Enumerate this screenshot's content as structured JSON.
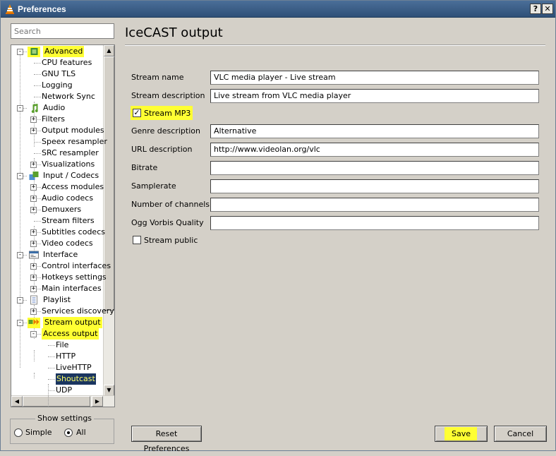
{
  "window": {
    "title": "Preferences",
    "help_button": "?",
    "close_button": "✕"
  },
  "search": {
    "placeholder": "Search"
  },
  "tree": {
    "items": [
      {
        "label": "Advanced",
        "level": 0,
        "expander": "−",
        "icon": "chip-icon",
        "highlight": true
      },
      {
        "label": "CPU features",
        "level": 1
      },
      {
        "label": "GNU TLS",
        "level": 1
      },
      {
        "label": "Logging",
        "level": 1
      },
      {
        "label": "Network Sync",
        "level": 1
      },
      {
        "label": "Audio",
        "level": 0,
        "expander": "−",
        "icon": "music-note-icon"
      },
      {
        "label": "Filters",
        "level": 1,
        "expander": "+"
      },
      {
        "label": "Output modules",
        "level": 1,
        "expander": "+"
      },
      {
        "label": "Speex resampler",
        "level": 1
      },
      {
        "label": "SRC resampler",
        "level": 1
      },
      {
        "label": "Visualizations",
        "level": 1,
        "expander": "+"
      },
      {
        "label": "Input / Codecs",
        "level": 0,
        "expander": "−",
        "icon": "codecs-icon"
      },
      {
        "label": "Access modules",
        "level": 1,
        "expander": "+"
      },
      {
        "label": "Audio codecs",
        "level": 1,
        "expander": "+"
      },
      {
        "label": "Demuxers",
        "level": 1,
        "expander": "+"
      },
      {
        "label": "Stream filters",
        "level": 1
      },
      {
        "label": "Subtitles codecs",
        "level": 1,
        "expander": "+"
      },
      {
        "label": "Video codecs",
        "level": 1,
        "expander": "+"
      },
      {
        "label": "Interface",
        "level": 0,
        "expander": "−",
        "icon": "interface-icon"
      },
      {
        "label": "Control interfaces",
        "level": 1,
        "expander": "+"
      },
      {
        "label": "Hotkeys settings",
        "level": 1,
        "expander": "+"
      },
      {
        "label": "Main interfaces",
        "level": 1,
        "expander": "+"
      },
      {
        "label": "Playlist",
        "level": 0,
        "expander": "−",
        "icon": "playlist-icon"
      },
      {
        "label": "Services discovery",
        "level": 1,
        "expander": "+"
      },
      {
        "label": "Stream output",
        "level": 0,
        "expander": "−",
        "icon": "stream-output-icon",
        "highlight": true
      },
      {
        "label": "Access output",
        "level": 1,
        "expander": "−",
        "highlight": true
      },
      {
        "label": "File",
        "level": 2
      },
      {
        "label": "HTTP",
        "level": 2
      },
      {
        "label": "LiveHTTP",
        "level": 2
      },
      {
        "label": "Shoutcast",
        "level": 2,
        "selected": true
      },
      {
        "label": "UDP",
        "level": 2
      }
    ]
  },
  "show_settings": {
    "title": "Show settings",
    "simple": "Simple",
    "all": "All",
    "selected": "All"
  },
  "panel": {
    "title": "IceCAST output",
    "fields": [
      {
        "label": "Stream name",
        "value": "VLC media player - Live stream"
      },
      {
        "label": "Stream description",
        "value": "Live stream from VLC media player"
      },
      {
        "label": "Genre description",
        "value": "Alternative"
      },
      {
        "label": "URL description",
        "value": "http://www.videolan.org/vlc"
      },
      {
        "label": "Bitrate",
        "value": ""
      },
      {
        "label": "Samplerate",
        "value": ""
      },
      {
        "label": "Number of channels",
        "value": ""
      },
      {
        "label": "Ogg Vorbis Quality",
        "value": ""
      }
    ],
    "stream_mp3": {
      "label": "Stream MP3",
      "checked": true
    },
    "stream_public": {
      "label": "Stream public",
      "checked": false
    }
  },
  "buttons": {
    "reset": "Reset Preferences",
    "save": "Save",
    "cancel": "Cancel"
  },
  "colors": {
    "highlight": "#ffff33",
    "selection": "#1a3560",
    "titlebar": "#2f5078"
  }
}
